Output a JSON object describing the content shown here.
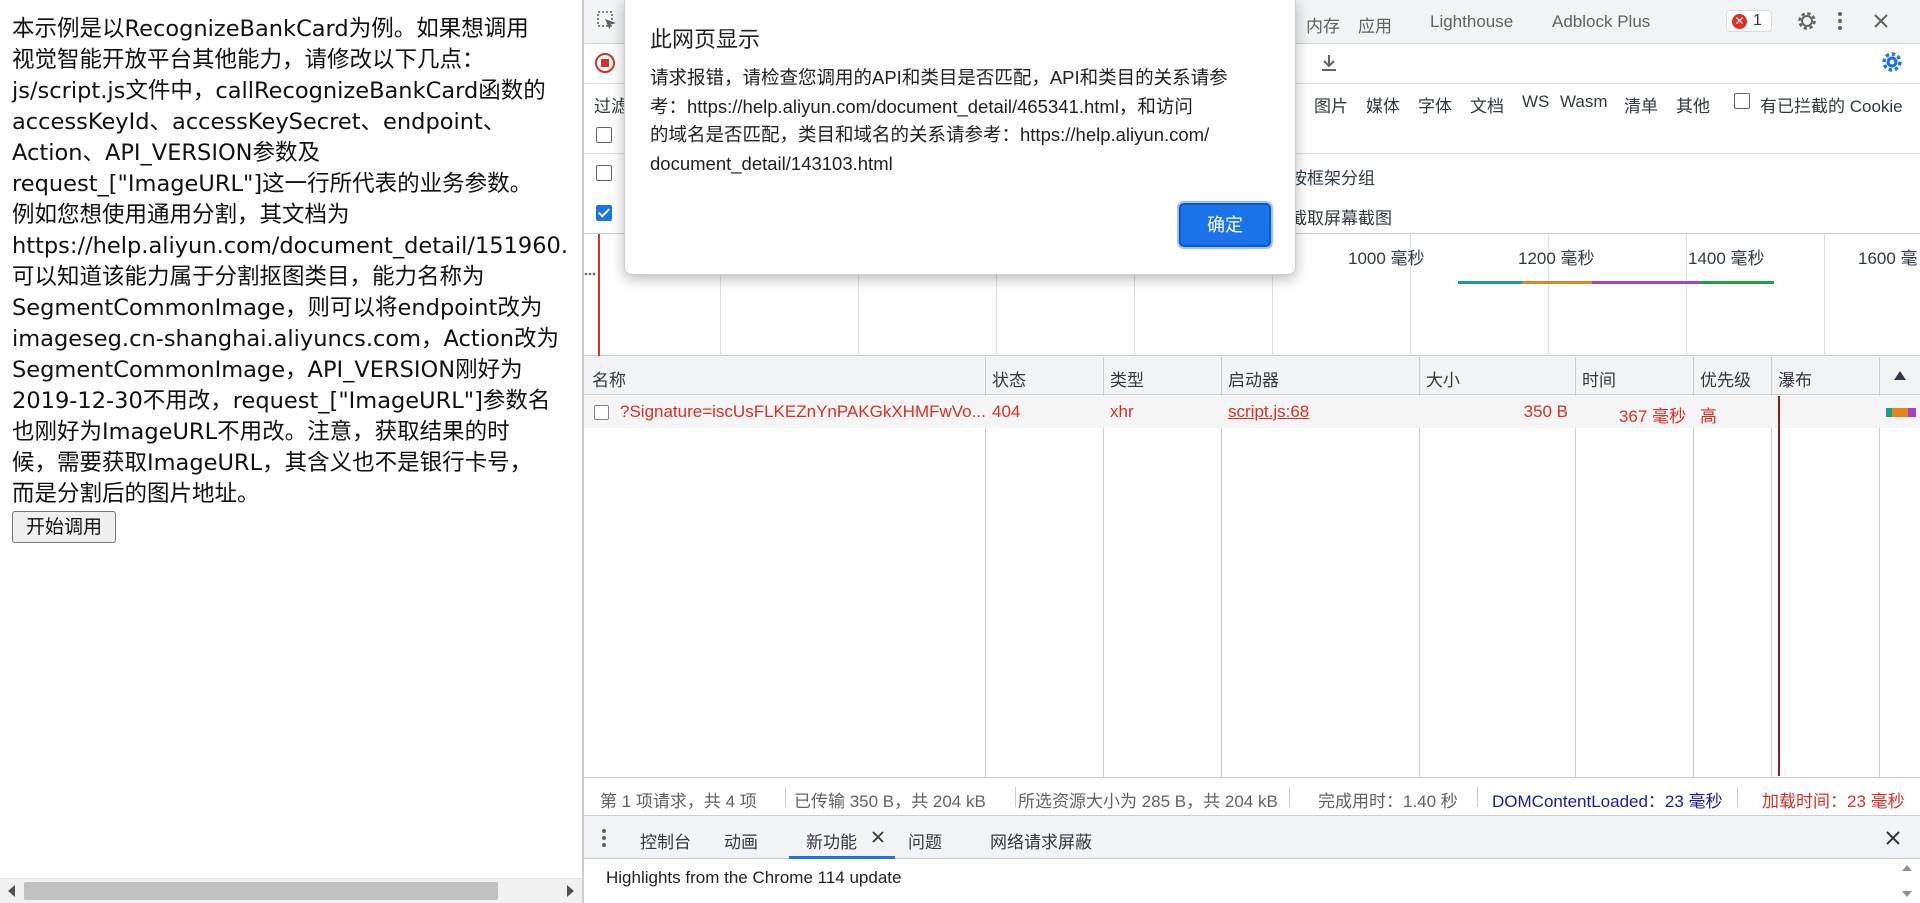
{
  "page": {
    "text_lines": [
      "本示例是以RecognizeBankCard为例。如果想调用",
      "视觉智能开放平台其他能力，请修改以下几点：",
      "js/script.js文件中，callRecognizeBankCard函数的",
      "accessKeyId、accessKeySecret、endpoint、",
      "Action、API_VERSION参数及",
      "request_[\"ImageURL\"]这一行所代表的业务参数。",
      "例如您想使用通用分割，其文档为",
      "https://help.aliyun.com/document_detail/151960.",
      "可以知道该能力属于分割抠图类目，能力名称为",
      "SegmentCommonImage，则可以将endpoint改为",
      "imageseg.cn-shanghai.aliyuncs.com，Action改为",
      "SegmentCommonImage，API_VERSION刚好为",
      "2019-12-30不用改，request_[\"ImageURL\"]参数名",
      "也刚好为ImageURL不用改。注意，获取结果的时",
      "候，需要获取ImageURL，其含义也不是银行卡号，",
      "而是分割后的图片地址。"
    ],
    "start_button": "开始调用"
  },
  "dialog": {
    "title": "此网页显示",
    "message_lines": [
      "请求报错，请检查您调用的API和类目是否匹配，API和类目的关系请参",
      "考：https://help.aliyun.com/document_detail/465341.html，和访问",
      "的域名是否匹配，类目和域名的关系请参考：https://help.aliyun.com/",
      "document_detail/143103.html"
    ],
    "ok_button": "确定"
  },
  "devtools": {
    "tabs": [
      "内存",
      "应用",
      "Lighthouse",
      "Adblock Plus"
    ],
    "error_count": "1",
    "filter_label": "过滤",
    "filter_types": [
      "图片",
      "媒体",
      "字体",
      "文档",
      "WS",
      "Wasm",
      "清单",
      "其他"
    ],
    "blocked_cookies": "有已拦截的 Cookie",
    "group_by_frame": "按框架分组",
    "capture_screenshots": "截取屏幕截图",
    "overview_ticks": [
      "1000 毫秒",
      "1200 毫秒",
      "1400 毫秒",
      "1600 毫"
    ],
    "columns": [
      "名称",
      "状态",
      "类型",
      "启动器",
      "大小",
      "时间",
      "优先级",
      "瀑布"
    ],
    "rows": [
      {
        "name": "?Signature=iscUsFLKEZnYnPAKGkXHMFwVo...",
        "status": "404",
        "type": "xhr",
        "initiator": "script.js:68",
        "size": "350 B",
        "time": "367 毫秒",
        "priority": "高"
      }
    ],
    "status": {
      "requests": "第 1 项请求，共 4 项",
      "transferred": "已传输 350 B，共 204 kB",
      "resources": "所选资源大小为 285 B，共 204 kB",
      "finish": "完成用时：1.40 秒",
      "dom_loaded": "DOMContentLoaded：23 毫秒",
      "load": "加载时间：23 毫秒"
    },
    "drawer_tabs": [
      "控制台",
      "动画",
      "新功能",
      "问题",
      "网络请求屏蔽"
    ],
    "drawer_content": "Highlights from the Chrome 114 update",
    "colors": {
      "error": "#d93025",
      "accent": "#1a73e8",
      "dom_loaded": "#1a1aa6"
    }
  }
}
